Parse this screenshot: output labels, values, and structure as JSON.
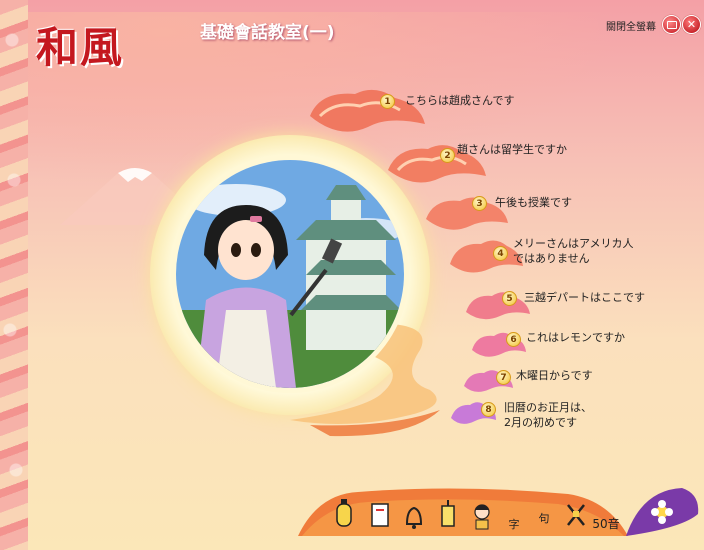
{
  "header": {
    "logo_text": "和風",
    "course_title": "基礎會話教室(一)",
    "fullscreen_label": "關閉全螢幕"
  },
  "lessons": [
    {
      "num": "1",
      "text": "こちらは趙成さんです"
    },
    {
      "num": "2",
      "text": "趙さんは留学生ですか"
    },
    {
      "num": "3",
      "text": "午後も授業です"
    },
    {
      "num": "4",
      "text": "メリーさんはアメリカ人",
      "text2": "ではありません"
    },
    {
      "num": "5",
      "text": "三越デパートはここです"
    },
    {
      "num": "6",
      "text": "これはレモンですか"
    },
    {
      "num": "7",
      "text": "木曜日からです"
    },
    {
      "num": "8",
      "text": "旧暦のお正月は、",
      "text2": "2月の初めです"
    }
  ],
  "toolbar": {
    "items": [
      {
        "name": "lantern-icon"
      },
      {
        "name": "book-icon"
      },
      {
        "name": "bell-icon"
      },
      {
        "name": "lamp-icon"
      },
      {
        "name": "girl-icon"
      },
      {
        "name": "kanji-icon",
        "label": "字"
      },
      {
        "name": "phrase-icon",
        "label": "句"
      },
      {
        "name": "swords-icon"
      }
    ],
    "gojuon_label": "50音"
  },
  "colors": {
    "accent": "#c4181f",
    "cloud": "#f06a50",
    "panel": "#fff9d9"
  }
}
